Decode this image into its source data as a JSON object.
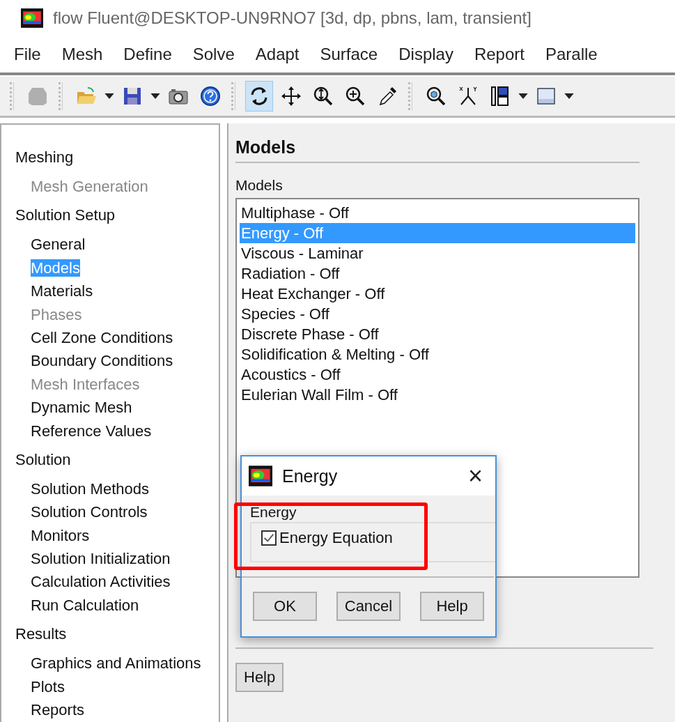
{
  "window": {
    "title": "flow Fluent@DESKTOP-UN9RNO7  [3d, dp, pbns, lam, transient]"
  },
  "menu": [
    "File",
    "Mesh",
    "Define",
    "Solve",
    "Adapt",
    "Surface",
    "Display",
    "Report",
    "Paralle"
  ],
  "toolbar": [
    [
      {
        "kind": "mesh",
        "disabled": true,
        "selected": false
      }
    ],
    [
      {
        "kind": "open",
        "disabled": false,
        "selected": false,
        "dropdown": true
      },
      {
        "kind": "save",
        "disabled": false,
        "selected": false,
        "dropdown": true
      },
      {
        "kind": "camera",
        "disabled": false,
        "selected": false
      },
      {
        "kind": "help",
        "disabled": false,
        "selected": false
      }
    ],
    [
      {
        "kind": "rotate",
        "disabled": false,
        "selected": true
      },
      {
        "kind": "move",
        "disabled": false,
        "selected": false
      },
      {
        "kind": "zoom",
        "disabled": false,
        "selected": false
      },
      {
        "kind": "zoomin",
        "disabled": false,
        "selected": false
      },
      {
        "kind": "probe",
        "disabled": false,
        "selected": false
      }
    ],
    [
      {
        "kind": "fit",
        "disabled": false,
        "selected": false
      },
      {
        "kind": "axes",
        "disabled": false,
        "selected": false
      },
      {
        "kind": "layout",
        "disabled": false,
        "selected": false,
        "dropdown": true
      },
      {
        "kind": "view",
        "disabled": false,
        "selected": false,
        "dropdown": true
      }
    ]
  ],
  "tree": [
    {
      "label": "Meshing",
      "children": [
        {
          "label": "Mesh Generation",
          "disabled": true,
          "selected": false
        }
      ]
    },
    {
      "label": "Solution Setup",
      "children": [
        {
          "label": "General",
          "disabled": false,
          "selected": false
        },
        {
          "label": "Models",
          "disabled": false,
          "selected": true
        },
        {
          "label": "Materials",
          "disabled": false,
          "selected": false
        },
        {
          "label": "Phases",
          "disabled": true,
          "selected": false
        },
        {
          "label": "Cell Zone Conditions",
          "disabled": false,
          "selected": false
        },
        {
          "label": "Boundary Conditions",
          "disabled": false,
          "selected": false
        },
        {
          "label": "Mesh Interfaces",
          "disabled": true,
          "selected": false
        },
        {
          "label": "Dynamic Mesh",
          "disabled": false,
          "selected": false
        },
        {
          "label": "Reference Values",
          "disabled": false,
          "selected": false
        }
      ]
    },
    {
      "label": "Solution",
      "children": [
        {
          "label": "Solution Methods",
          "disabled": false,
          "selected": false
        },
        {
          "label": "Solution Controls",
          "disabled": false,
          "selected": false
        },
        {
          "label": "Monitors",
          "disabled": false,
          "selected": false
        },
        {
          "label": "Solution Initialization",
          "disabled": false,
          "selected": false
        },
        {
          "label": "Calculation Activities",
          "disabled": false,
          "selected": false
        },
        {
          "label": "Run Calculation",
          "disabled": false,
          "selected": false
        }
      ]
    },
    {
      "label": "Results",
      "children": [
        {
          "label": "Graphics and Animations",
          "disabled": false,
          "selected": false
        },
        {
          "label": "Plots",
          "disabled": false,
          "selected": false
        },
        {
          "label": "Reports",
          "disabled": false,
          "selected": false
        }
      ]
    }
  ],
  "panel": {
    "title": "Models",
    "list_label": "Models",
    "models": [
      {
        "label": "Multiphase - Off",
        "selected": false
      },
      {
        "label": "Energy - Off",
        "selected": true
      },
      {
        "label": "Viscous - Laminar",
        "selected": false
      },
      {
        "label": "Radiation - Off",
        "selected": false
      },
      {
        "label": "Heat Exchanger - Off",
        "selected": false
      },
      {
        "label": "Species - Off",
        "selected": false
      },
      {
        "label": "Discrete Phase - Off",
        "selected": false
      },
      {
        "label": "Solidification & Melting - Off",
        "selected": false
      },
      {
        "label": "Acoustics - Off",
        "selected": false
      },
      {
        "label": "Eulerian Wall Film - Off",
        "selected": false
      }
    ],
    "help_button": "Help"
  },
  "dialog": {
    "title": "Energy",
    "close": "×",
    "group_label": "Energy",
    "checkbox": {
      "label": "Energy Equation",
      "checked": true
    },
    "buttons": [
      "OK",
      "Cancel",
      "Help"
    ]
  }
}
